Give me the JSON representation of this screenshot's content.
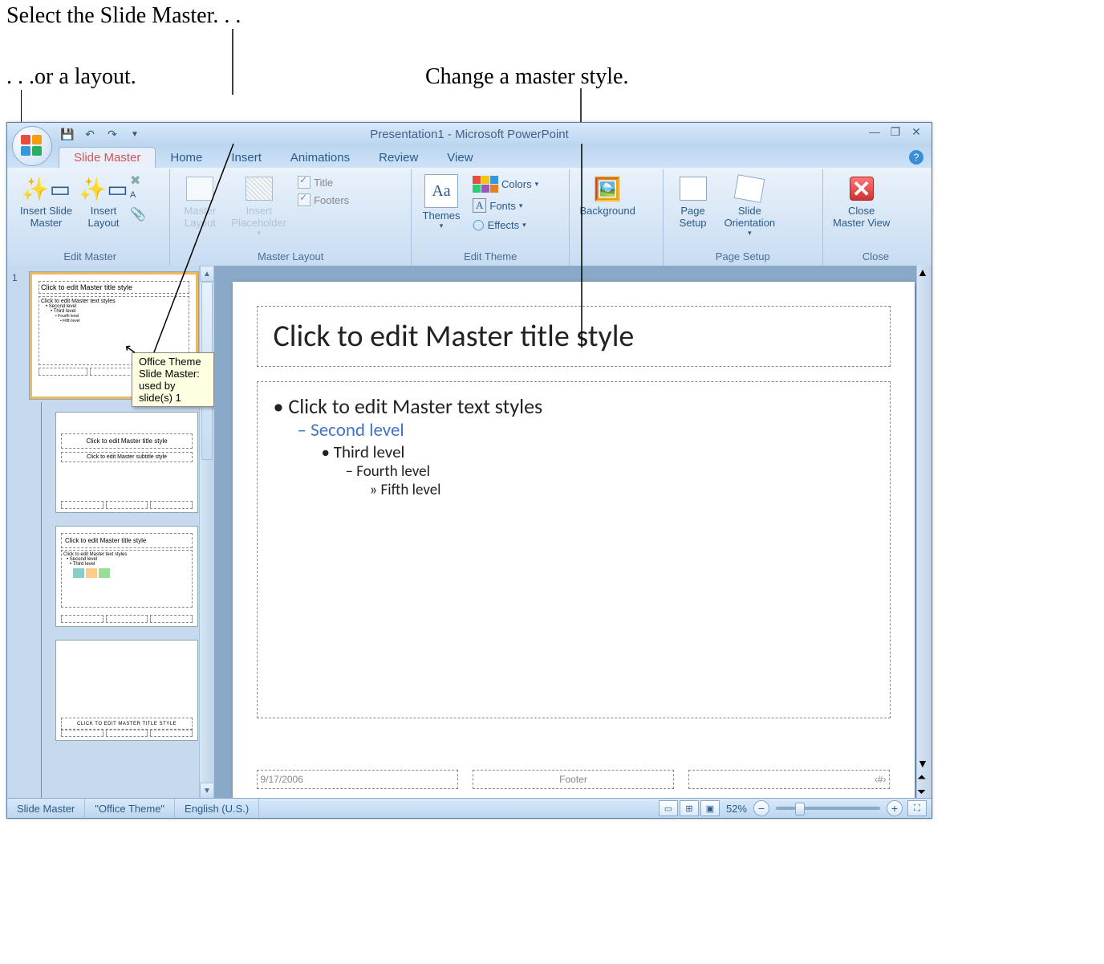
{
  "annotations": {
    "top": "Select the Slide Master. . .",
    "left": ". . .or a layout.",
    "right": "Change a master style."
  },
  "app": {
    "title": "Presentation1 - Microsoft PowerPoint",
    "tabs": [
      "Slide Master",
      "Home",
      "Insert",
      "Animations",
      "Review",
      "View"
    ],
    "active_tab": 0
  },
  "ribbon": {
    "edit_master": {
      "label": "Edit Master",
      "insert_slide_master": "Insert Slide\nMaster",
      "insert_layout": "Insert\nLayout"
    },
    "master_layout": {
      "label": "Master Layout",
      "master_layout_btn": "Master\nLayout",
      "insert_placeholder_btn": "Insert\nPlaceholder",
      "title_chk": "Title",
      "footers_chk": "Footers"
    },
    "edit_theme": {
      "label": "Edit Theme",
      "themes_btn": "Themes",
      "colors": "Colors",
      "fonts": "Fonts",
      "effects": "Effects"
    },
    "background": {
      "label": "Background"
    },
    "page_setup": {
      "label": "Page Setup",
      "page_setup_btn": "Page\nSetup",
      "orientation_btn": "Slide\nOrientation"
    },
    "close": {
      "label": "Close",
      "close_btn": "Close\nMaster View"
    }
  },
  "tooltip": "Office Theme Slide Master: used by slide(s) 1",
  "thumbnails": {
    "master": {
      "title": "Click to edit Master title style",
      "body": "Click to edit Master text styles"
    },
    "layouts": [
      {
        "title": "Click to edit Master title style",
        "sub": "Click to edit Master subtitle style"
      },
      {
        "title": "Click to edit Master title style",
        "body": "Click to edit Master text styles"
      },
      {
        "title": "CLICK TO EDIT MASTER TITLE STYLE"
      }
    ]
  },
  "slide": {
    "title": "Click to edit Master title style",
    "l1": "Click to edit Master text styles",
    "l2": "Second level",
    "l3": "Third level",
    "l4": "Fourth level",
    "l5": "Fifth level",
    "date": "9/17/2006",
    "footer": "Footer",
    "num": "‹#›"
  },
  "status": {
    "view": "Slide Master",
    "theme": "\"Office Theme\"",
    "lang": "English (U.S.)",
    "zoom": "52%"
  }
}
